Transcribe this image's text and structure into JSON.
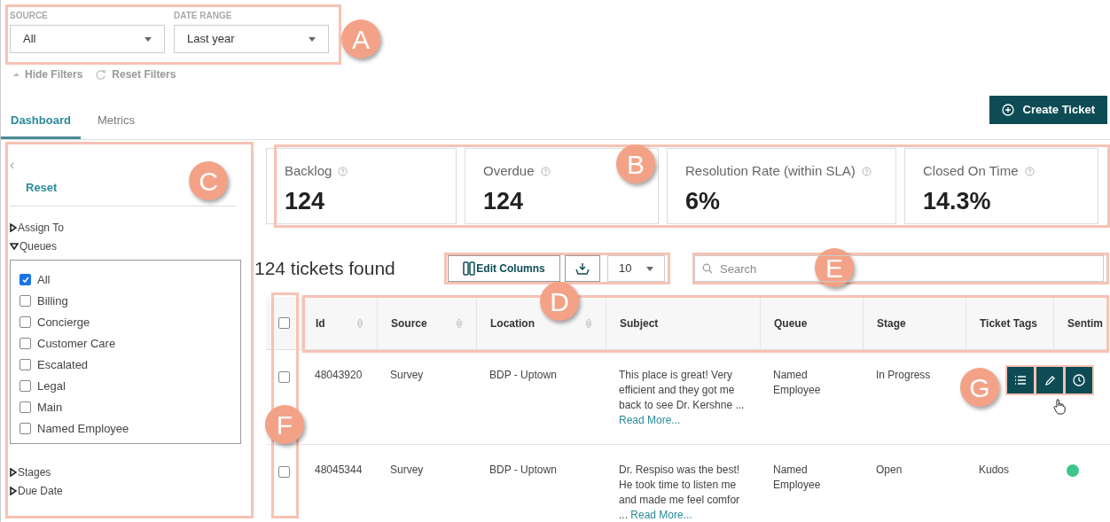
{
  "filters": [
    {
      "label": "SOURCE",
      "value": "All"
    },
    {
      "label": "DATE RANGE",
      "value": "Last year"
    }
  ],
  "filter_actions": {
    "hide": "Hide Filters",
    "reset": "Reset Filters"
  },
  "tabs": [
    {
      "label": "Dashboard",
      "selected": true
    },
    {
      "label": "Metrics",
      "selected": false
    }
  ],
  "create_button": "Create Ticket",
  "sidebar": {
    "collapse": "‹",
    "reset": "Reset",
    "sections": [
      {
        "label": "Assign To",
        "expanded": false
      },
      {
        "label": "Queues",
        "expanded": true,
        "options": [
          {
            "label": "All",
            "checked": true
          },
          {
            "label": "Billing",
            "checked": false
          },
          {
            "label": "Concierge",
            "checked": false
          },
          {
            "label": "Customer Care",
            "checked": false
          },
          {
            "label": "Escalated",
            "checked": false
          },
          {
            "label": "Legal",
            "checked": false
          },
          {
            "label": "Main",
            "checked": false
          },
          {
            "label": "Named Employee",
            "checked": false
          }
        ]
      },
      {
        "label": "Stages",
        "expanded": false
      },
      {
        "label": "Due Date",
        "expanded": false
      }
    ]
  },
  "metrics": [
    {
      "label": "Backlog",
      "value": "124"
    },
    {
      "label": "Overdue",
      "value": "124"
    },
    {
      "label": "Resolution Rate (within SLA)",
      "value": "6%"
    },
    {
      "label": "Closed On Time",
      "value": "14.3%"
    }
  ],
  "results": {
    "count": "124 tickets found",
    "edit_columns": "Edit Columns",
    "page_size": "10",
    "search_placeholder": "Search"
  },
  "table": {
    "select_all": false,
    "columns": [
      {
        "label": "Id",
        "sortable": true
      },
      {
        "label": "Source",
        "sortable": true
      },
      {
        "label": "Location",
        "sortable": true
      },
      {
        "label": "Subject",
        "sortable": false
      },
      {
        "label": "Queue",
        "sortable": false
      },
      {
        "label": "Stage",
        "sortable": false
      },
      {
        "label": "Ticket Tags",
        "sortable": false
      },
      {
        "label": "Sentim",
        "sortable": false
      }
    ],
    "rows": [
      {
        "checked": false,
        "hovered": true,
        "id": "48043920",
        "source": "Survey",
        "location": "BDP - Uptown",
        "subject": "This place is great! Very efficient and they got me back to see Dr. Kershne ...",
        "read_more": "Read More...",
        "queue": "Named Employee",
        "stage": "In Progress"
      },
      {
        "checked": false,
        "hovered": false,
        "id": "48045344",
        "source": "Survey",
        "location": "BDP - Uptown",
        "subject": "Dr. Respiso was the best! He took time to listen me and made me feel comfor ...",
        "read_more": "Read More...",
        "queue": "Named Employee",
        "stage": "Open",
        "tag": "Kudos",
        "color": "#3cc68a"
      }
    ]
  },
  "annotations": [
    {
      "label": "A"
    },
    {
      "label": "B"
    },
    {
      "label": "C"
    },
    {
      "label": "D"
    },
    {
      "label": "E"
    },
    {
      "label": "F"
    },
    {
      "label": "G"
    }
  ]
}
